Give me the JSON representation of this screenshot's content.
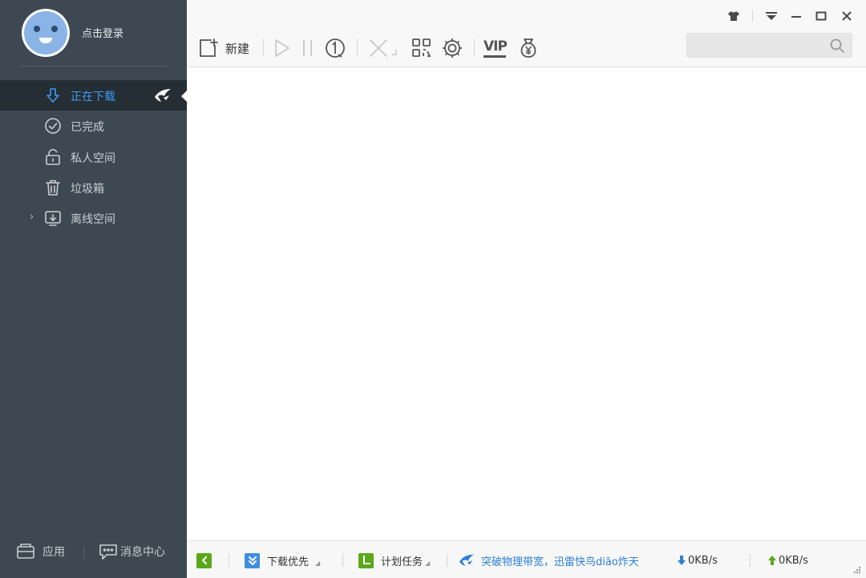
{
  "sidebar": {
    "login_text": "点击登录",
    "nav_items": [
      {
        "label": "正在下载",
        "icon": "download-icon",
        "active": true
      },
      {
        "label": "已完成",
        "icon": "check-circle-icon",
        "active": false
      },
      {
        "label": "私人空间",
        "icon": "lock-icon",
        "active": false
      },
      {
        "label": "垃圾箱",
        "icon": "trash-icon",
        "active": false
      },
      {
        "label": "离线空间",
        "icon": "cloud-download-icon",
        "active": false
      }
    ],
    "bottom": {
      "apps_label": "应用",
      "message_center_label": "消息中心"
    }
  },
  "toolbar": {
    "new_label": "新建",
    "vip_label": "VIP",
    "search_placeholder": ""
  },
  "statusbar": {
    "download_priority_label": "下载优先",
    "scheduled_tasks_label": "计划任务",
    "promo_text": "突破物理带宽，迅雷快鸟diāo炸天",
    "download_speed": "0KB/s",
    "upload_speed": "0KB/s"
  },
  "colors": {
    "sidebar_bg": "#3e4852",
    "sidebar_active_bg": "#252d35",
    "accent_blue": "#3d9bf2",
    "green_accent": "#5aa81a"
  }
}
